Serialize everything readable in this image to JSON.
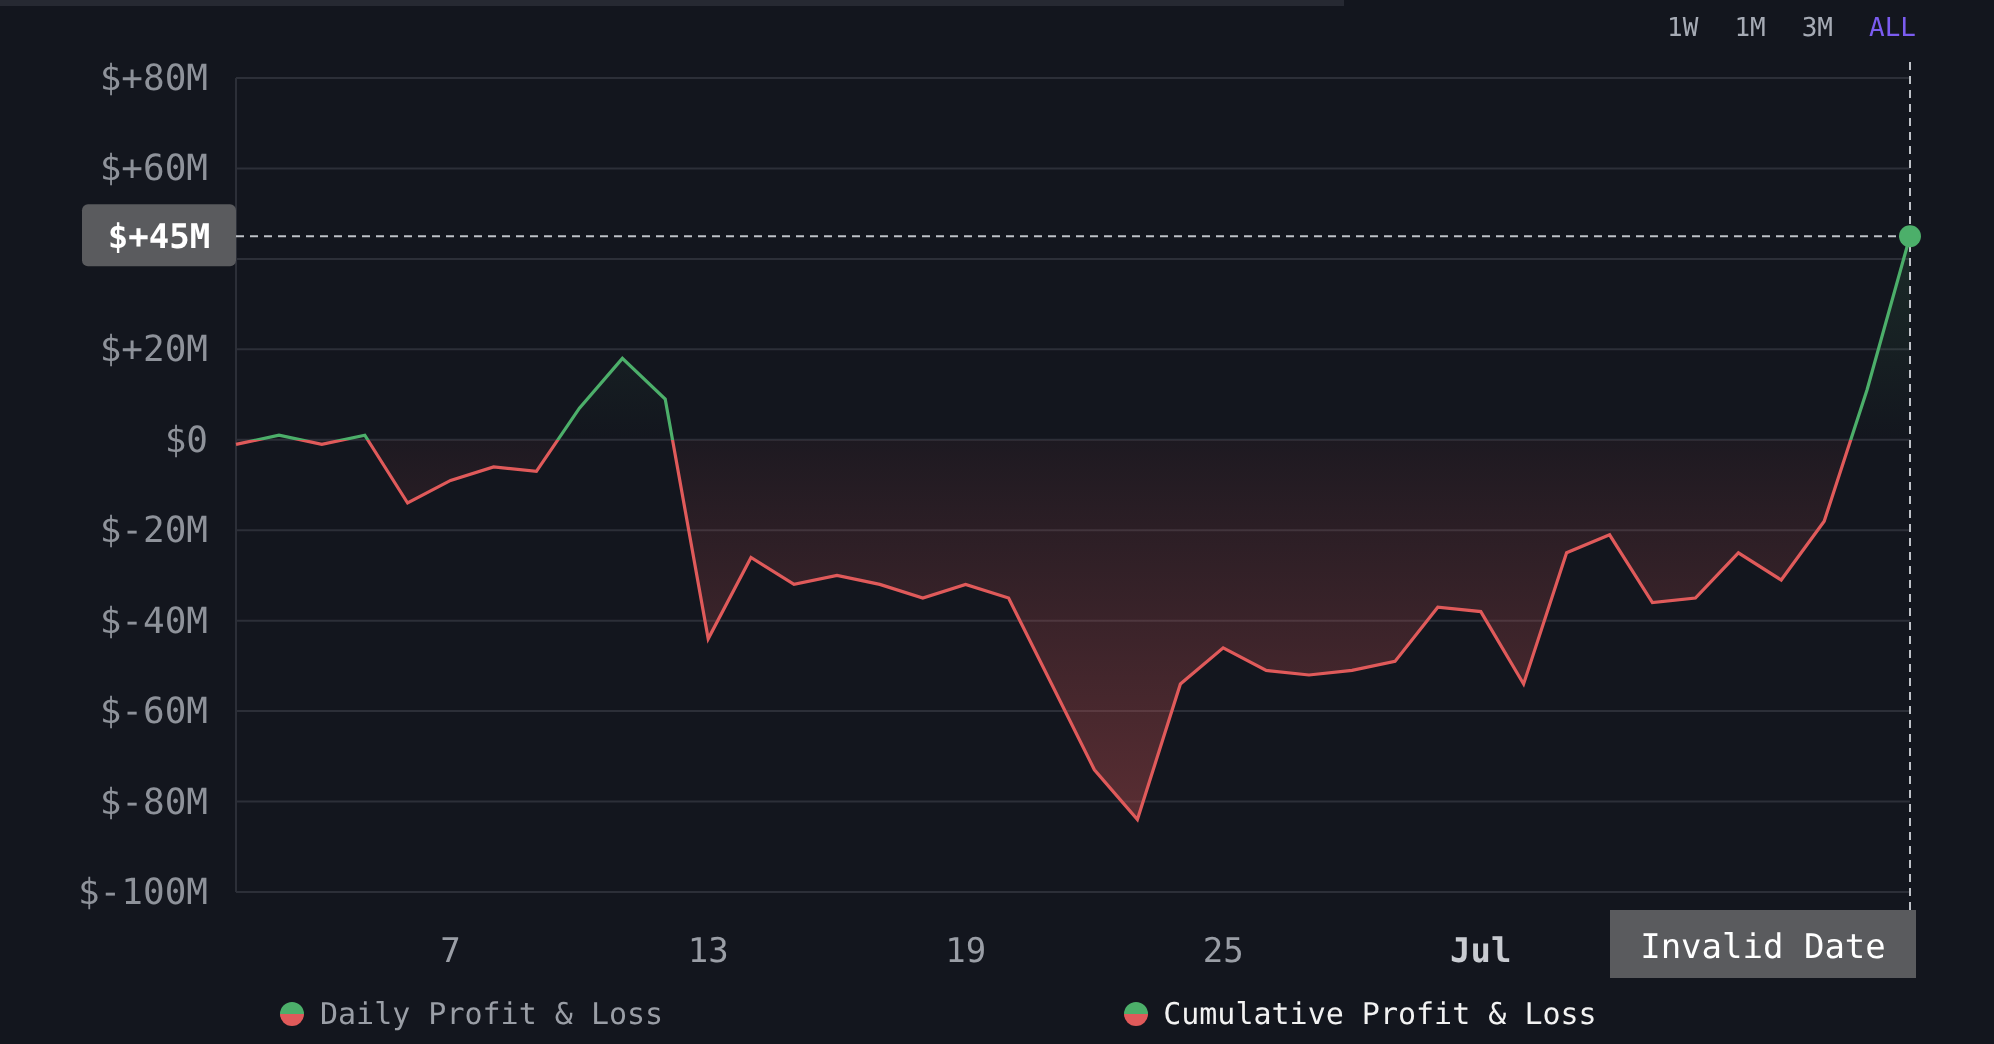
{
  "ranges": [
    {
      "label": "1W",
      "selected": false
    },
    {
      "label": "1M",
      "selected": false
    },
    {
      "label": "3M",
      "selected": false
    },
    {
      "label": "ALL",
      "selected": true
    }
  ],
  "chart": {
    "chart_data": {
      "type": "area",
      "categories": [
        null,
        null,
        null,
        null,
        null,
        "7",
        null,
        null,
        null,
        null,
        null,
        "13",
        null,
        null,
        null,
        null,
        null,
        "19",
        null,
        null,
        null,
        null,
        null,
        "25",
        null,
        null,
        null,
        null,
        null,
        "Jul",
        null,
        null,
        null,
        null,
        null,
        null,
        null,
        null,
        null,
        null
      ],
      "series": [
        {
          "name": "Cumulative Profit & Loss",
          "color": "#e05a5a",
          "values": [
            -1,
            1,
            -1,
            1,
            -14,
            -9,
            -6,
            -7,
            7,
            18,
            9,
            -44,
            -26,
            -32,
            -30,
            -32,
            -35,
            -32,
            -35,
            -54,
            -73,
            -84,
            -54,
            -46,
            -51,
            -52,
            -51,
            -49,
            -37,
            -38,
            -54,
            -25,
            -21,
            -36,
            -35,
            -25,
            -31,
            -18,
            11,
            45
          ]
        }
      ],
      "ylim": [
        -100,
        80
      ],
      "grid": true,
      "ref_lines": [
        {
          "axis": "y",
          "value": 45,
          "label": "$+45M"
        }
      ],
      "yticks": [
        {
          "value": 80,
          "label": "$+80M"
        },
        {
          "value": 60,
          "label": "$+60M"
        },
        {
          "value": 20,
          "label": "$+20M"
        },
        {
          "value": 0,
          "label": "$0"
        },
        {
          "value": -20,
          "label": "$-20M"
        },
        {
          "value": -40,
          "label": "$-40M"
        },
        {
          "value": -60,
          "label": "$-60M"
        },
        {
          "value": -80,
          "label": "$-80M"
        },
        {
          "value": -100,
          "label": "$-100M"
        }
      ]
    },
    "cursor": {
      "x_label": "Invalid Date"
    }
  },
  "legend": [
    {
      "label": "Daily Profit & Loss",
      "selected": false
    },
    {
      "selected": true
    }
  ]
}
